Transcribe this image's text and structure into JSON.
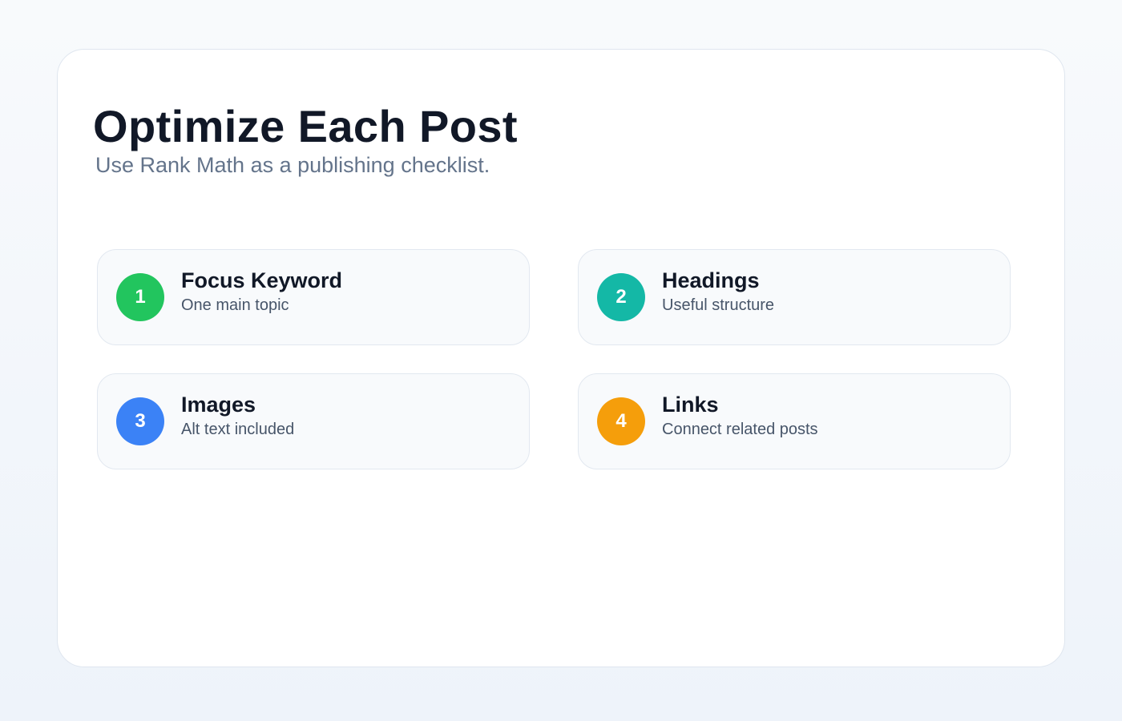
{
  "header": {
    "title": "Optimize Each Post",
    "subtitle": "Use Rank Math as a publishing checklist."
  },
  "checklist": [
    {
      "number": "1",
      "title": "Focus Keyword",
      "description": "One main topic",
      "color": "#22c55e"
    },
    {
      "number": "2",
      "title": "Headings",
      "description": "Useful structure",
      "color": "#14b8a6"
    },
    {
      "number": "3",
      "title": "Images",
      "description": "Alt text included",
      "color": "#3b82f6"
    },
    {
      "number": "4",
      "title": "Links",
      "description": "Connect related posts",
      "color": "#f59e0b"
    }
  ]
}
